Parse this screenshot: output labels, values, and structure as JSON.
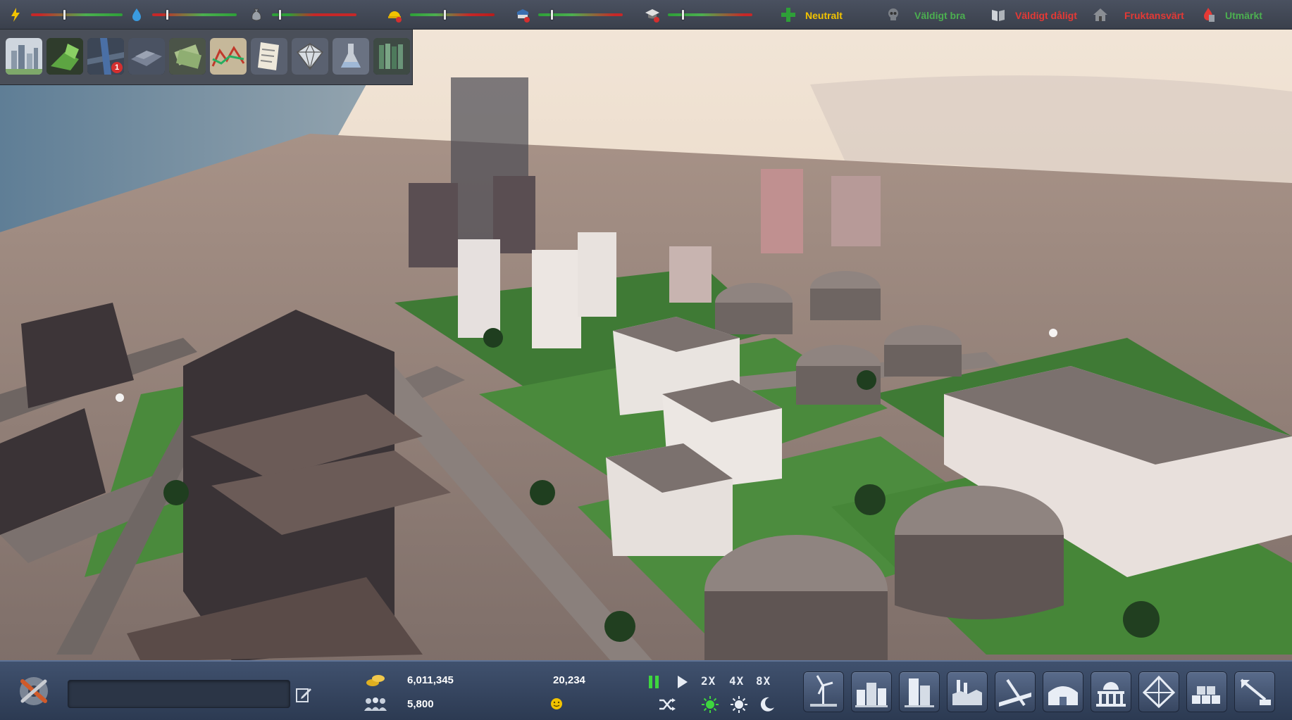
{
  "top_status": {
    "statuses": [
      {
        "icon": "plus-icon",
        "text": "Neutralt",
        "color": "#f2c300"
      },
      {
        "icon": "skull-icon",
        "text": "Väldigt bra",
        "color": "#4caf50"
      },
      {
        "icon": "book-icon",
        "text": "Väldigt dåligt",
        "color": "#e53935"
      },
      {
        "icon": "house-icon",
        "text": "Fruktansvärt",
        "color": "#e53935"
      },
      {
        "icon": "fire-icon",
        "text": "Utmärkt",
        "color": "#4caf50"
      }
    ],
    "meters": [
      {
        "icon": "power-icon",
        "level": 0.35
      },
      {
        "icon": "water-drop-icon",
        "level": 0.17
      },
      {
        "icon": "garbage-bag-icon",
        "level": 0.08
      },
      {
        "icon": "worker-helmet-icon",
        "level": 0.4
      },
      {
        "icon": "police-icon",
        "level": 0.15
      },
      {
        "icon": "education-icon",
        "level": 0.17
      }
    ]
  },
  "toolbar": {
    "tools": [
      {
        "name": "city-overview-tool",
        "icon": "city-icon"
      },
      {
        "name": "zoning-map-tool",
        "icon": "map-icon"
      },
      {
        "name": "traffic-tool",
        "icon": "road-icon",
        "badge": "1"
      },
      {
        "name": "districts-tool",
        "icon": "grid-icon"
      },
      {
        "name": "finances-tool",
        "icon": "money-icon"
      },
      {
        "name": "statistics-tool",
        "icon": "graph-icon"
      },
      {
        "name": "policies-tool",
        "icon": "scroll-icon"
      },
      {
        "name": "resources-tool",
        "icon": "gem-icon"
      },
      {
        "name": "research-tool",
        "icon": "flask-icon"
      },
      {
        "name": "library-tool",
        "icon": "books-icon"
      }
    ]
  },
  "bottom": {
    "city_name": "",
    "money": "6,011,345",
    "population": "5,800",
    "score": "20,234",
    "speed_2x": "2X",
    "speed_4x": "4X",
    "speed_8x": "8X",
    "build_buttons": [
      {
        "name": "power-build-button",
        "icon": "wind-turbine-icon"
      },
      {
        "name": "residential-build-button",
        "icon": "houses-icon"
      },
      {
        "name": "commercial-build-button",
        "icon": "office-icon"
      },
      {
        "name": "industrial-build-button",
        "icon": "factory-icon"
      },
      {
        "name": "roads-build-button",
        "icon": "road-build-icon"
      },
      {
        "name": "services-build-button",
        "icon": "service-building-icon"
      },
      {
        "name": "government-build-button",
        "icon": "capitol-icon"
      },
      {
        "name": "landmark-build-button",
        "icon": "pyramid-icon"
      },
      {
        "name": "storage-build-button",
        "icon": "crates-icon"
      },
      {
        "name": "bulldoze-button",
        "icon": "crane-icon"
      }
    ]
  },
  "colors": {
    "good": "#4caf50",
    "bad": "#e53935",
    "neutral": "#f2c300",
    "bottom_bar": "#34445e"
  }
}
